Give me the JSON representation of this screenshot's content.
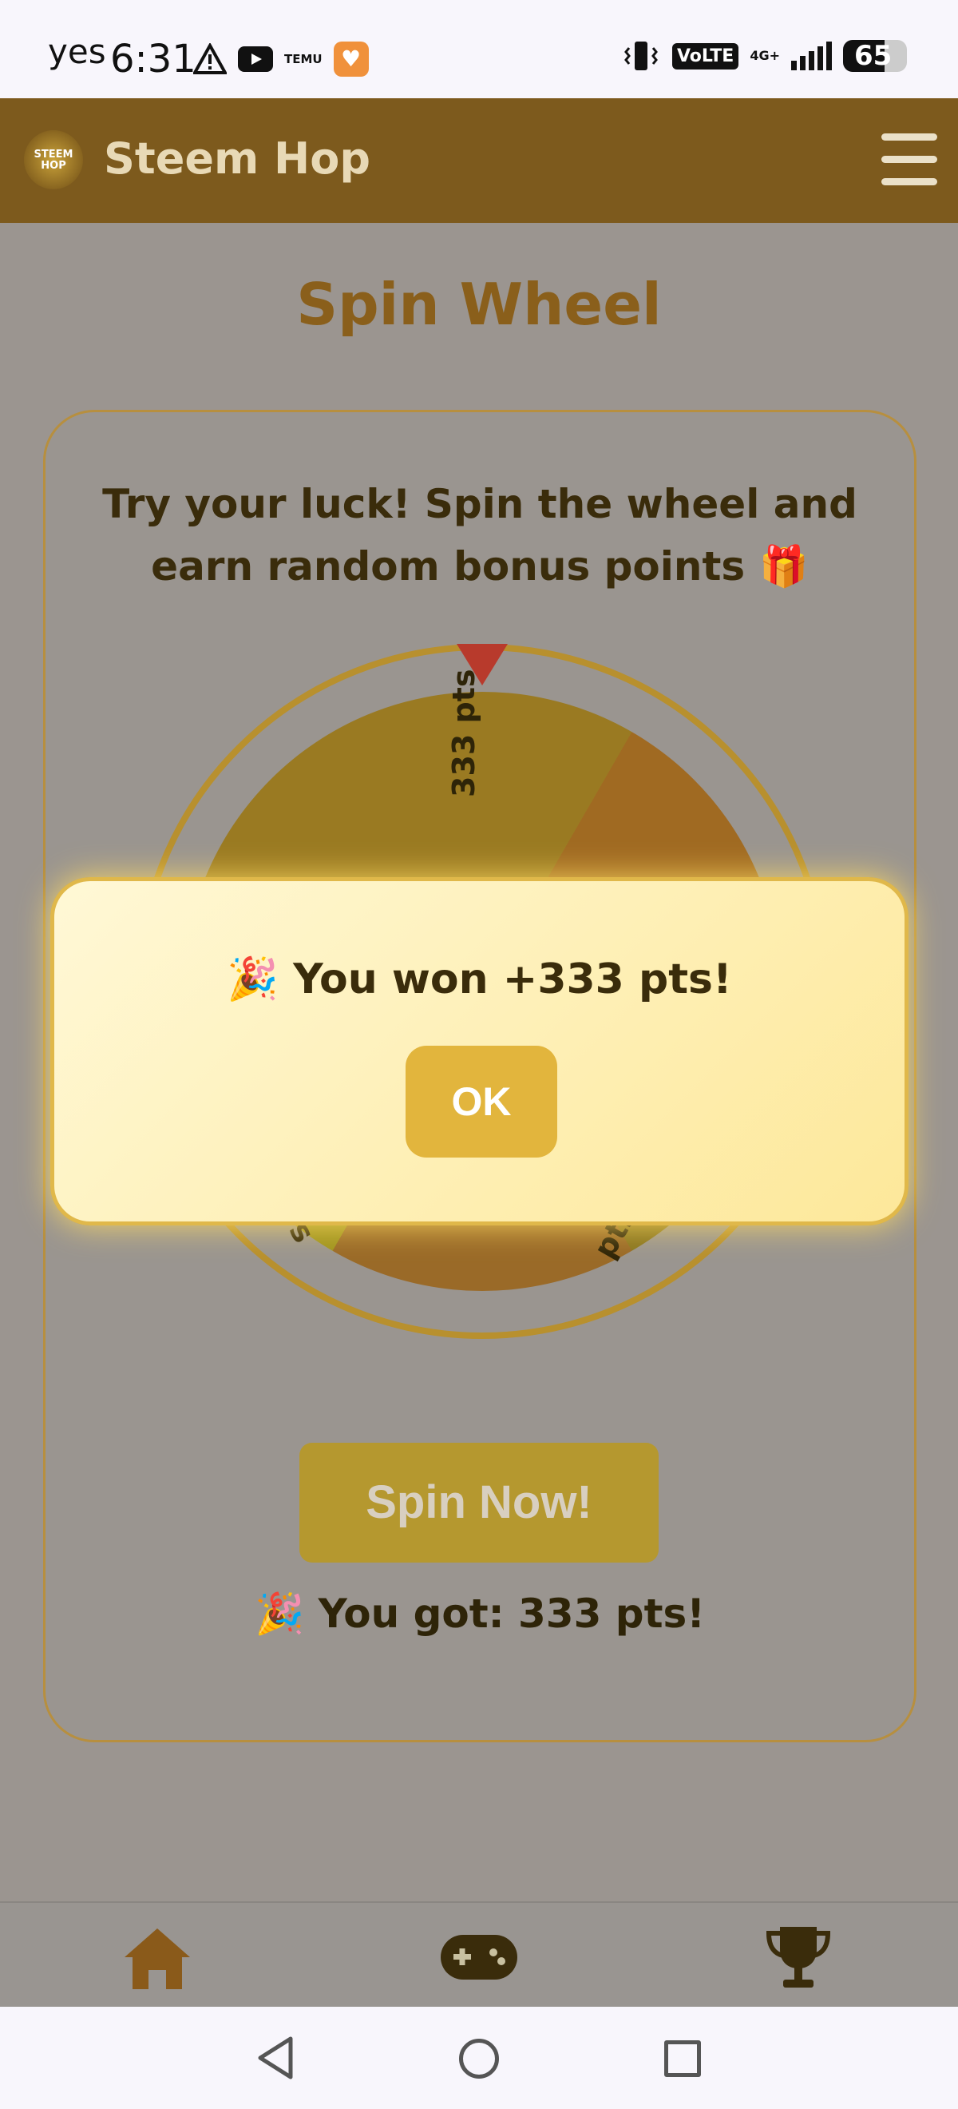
{
  "status_bar": {
    "carrier": "yes",
    "time": "6:31",
    "temu_label": "TEMU",
    "volte": "VoLTE",
    "network": "4G+",
    "battery": "65",
    "battery_level": 0.65
  },
  "header": {
    "logo_text": "STEEM HOP",
    "brand": "Steem Hop"
  },
  "main": {
    "title": "Spin Wheel",
    "intro": "Try your luck! Spin the wheel and earn random bonus points 🎁",
    "wheel_labels": {
      "top": "333 pts",
      "bottom_left": "s",
      "bottom_right": "pts"
    },
    "spin_button": "Spin Now!",
    "result": "🎉 You got: 333 pts!"
  },
  "modal": {
    "message": "🎉 You won +333 pts!",
    "ok_button": "OK"
  },
  "colors": {
    "header_bg": "#7d5a1d",
    "accent": "#e2b53d",
    "title": "#8a5f1b"
  }
}
